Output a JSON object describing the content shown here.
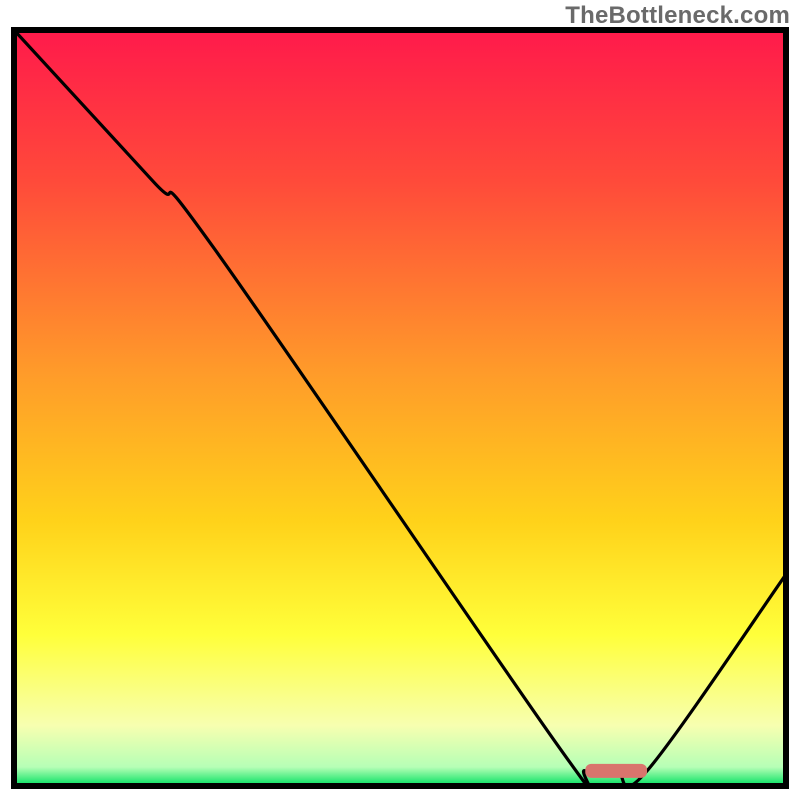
{
  "watermark": "TheBottleneck.com",
  "chart_data": {
    "type": "line",
    "title": "",
    "xlabel": "",
    "ylabel": "",
    "xlim": [
      0,
      100
    ],
    "ylim": [
      0,
      100
    ],
    "gradient_stops": [
      {
        "pos": 0.0,
        "color": "#ff1a4b"
      },
      {
        "pos": 0.2,
        "color": "#ff4a3a"
      },
      {
        "pos": 0.45,
        "color": "#ff9a2a"
      },
      {
        "pos": 0.65,
        "color": "#ffd21a"
      },
      {
        "pos": 0.8,
        "color": "#ffff3a"
      },
      {
        "pos": 0.92,
        "color": "#f7ffb0"
      },
      {
        "pos": 0.975,
        "color": "#b6ffb6"
      },
      {
        "pos": 1.0,
        "color": "#00e060"
      }
    ],
    "curve_points": [
      {
        "x": 0,
        "y": 100
      },
      {
        "x": 18,
        "y": 80
      },
      {
        "x": 26,
        "y": 71
      },
      {
        "x": 70,
        "y": 6
      },
      {
        "x": 74,
        "y": 2
      },
      {
        "x": 78,
        "y": 2
      },
      {
        "x": 82,
        "y": 2
      },
      {
        "x": 100,
        "y": 28
      }
    ],
    "marker": {
      "x_start": 74,
      "x_end": 82,
      "y": 2,
      "color": "#d9746d"
    },
    "border_color": "#000000",
    "border_width": 6
  }
}
